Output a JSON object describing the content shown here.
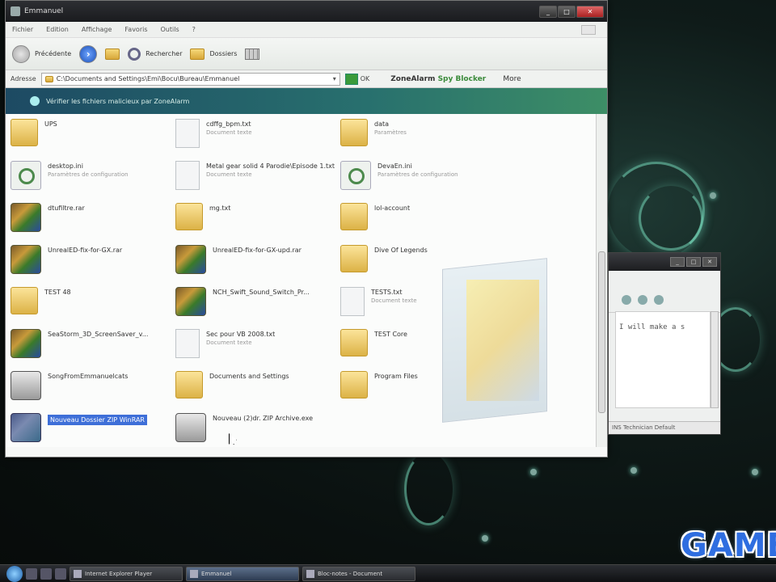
{
  "window": {
    "title": "Emmanuel",
    "min": "_",
    "max": "□",
    "close": "✕"
  },
  "menu": [
    "Fichier",
    "Edition",
    "Affichage",
    "Favoris",
    "Outils",
    "?"
  ],
  "toolbar": {
    "back_label": "Précédente",
    "search_label": "Rechercher",
    "folders_label": "Dossiers"
  },
  "address": {
    "label": "Adresse",
    "path": "C:\\Documents and Settings\\Emi\\Bocu\\Bureau\\Emmanuel",
    "go_label": "OK",
    "zonealarm": "ZoneAlarm",
    "spy_blocker": "Spy Blocker",
    "more": "More"
  },
  "ribbon": {
    "text": "Vérifier les fichiers malicieux par ZoneAlarm"
  },
  "files": [
    {
      "name": "UPS",
      "sub": "",
      "icon": "folder"
    },
    {
      "name": "cdffg_bpm.txt",
      "sub": "Document texte",
      "icon": "doc"
    },
    {
      "name": "data",
      "sub": "Paramètres",
      "icon": "folder"
    },
    {
      "name": "desktop.ini",
      "sub": "Paramètres de configuration",
      "icon": "cfg"
    },
    {
      "name": "Metal gear solid 4 Parodie\\Episode 1.txt",
      "sub": "Document texte",
      "icon": "doc"
    },
    {
      "name": "DevaEn.ini",
      "sub": "Paramètres de configuration",
      "icon": "cfg"
    },
    {
      "name": "dtufiltre.rar",
      "sub": "",
      "icon": "zip"
    },
    {
      "name": "mg.txt",
      "sub": "",
      "icon": "folder"
    },
    {
      "name": "lol-account",
      "sub": "",
      "icon": "folder"
    },
    {
      "name": "UnrealED-fix-for-GX.rar",
      "sub": "",
      "icon": "zip"
    },
    {
      "name": "UnrealED-fix-for-GX-upd.rar",
      "sub": "",
      "icon": "zip"
    },
    {
      "name": "Dive Of Legends",
      "sub": "",
      "icon": "folder"
    },
    {
      "name": "TEST 48",
      "sub": "",
      "icon": "folder"
    },
    {
      "name": "NCH_Swift_Sound_Switch_Pr...",
      "sub": "",
      "icon": "zip"
    },
    {
      "name": "TESTS.txt",
      "sub": "Document texte",
      "icon": "doc"
    },
    {
      "name": "SeaStorm_3D_ScreenSaver_v...",
      "sub": "",
      "icon": "zip"
    },
    {
      "name": "Sec pour VB 2008.txt",
      "sub": "Document texte",
      "icon": "doc"
    },
    {
      "name": "TEST Core",
      "sub": "",
      "icon": "folder"
    },
    {
      "name": "SongFromEmmanuelcats",
      "sub": "",
      "icon": "cab"
    },
    {
      "name": "Documents and Settings",
      "sub": "",
      "icon": "folder"
    },
    {
      "name": "Program Files",
      "sub": "",
      "icon": "folder"
    },
    {
      "name": "Nouveau Dossier ZIP WinRAR",
      "sub": "",
      "icon": "zipsel"
    },
    {
      "name": "Nouveau (2)dr. ZIP Archive.exe",
      "sub": "",
      "icon": "cab"
    }
  ],
  "secondary_window": {
    "text": "I will make a s",
    "status": "INS   Technician Default"
  },
  "logo": "GAME",
  "taskbar": {
    "tasks": [
      "Internet Explorer Player",
      "Emmanuel",
      "Bloc-notes - Document"
    ]
  }
}
